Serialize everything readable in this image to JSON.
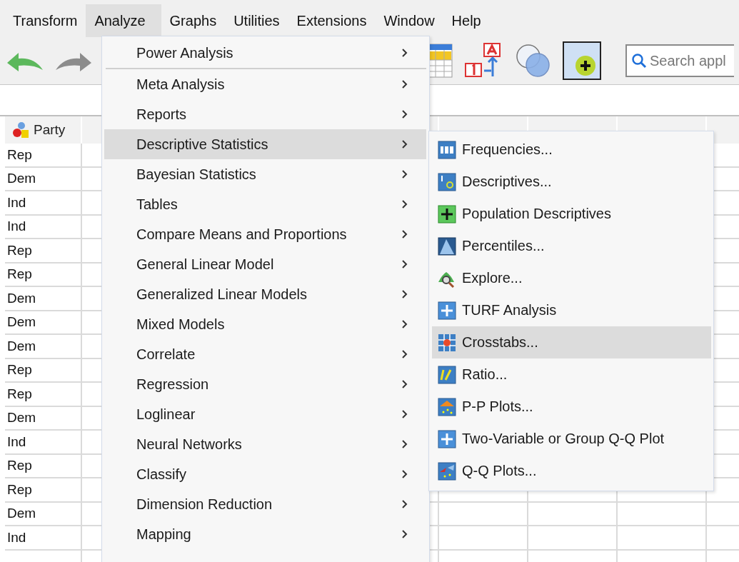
{
  "menubar": [
    {
      "label": "Transform",
      "selected": false
    },
    {
      "label": "Analyze",
      "selected": true
    },
    {
      "label": "Graphs",
      "selected": false
    },
    {
      "label": "Utilities",
      "selected": false
    },
    {
      "label": "Extensions",
      "selected": false
    },
    {
      "label": "Window",
      "selected": false
    },
    {
      "label": "Help",
      "selected": false
    }
  ],
  "toolbar": {
    "search": {
      "placeholder": "Search appl"
    }
  },
  "grid": {
    "columns": [
      "Party"
    ],
    "rows": [
      "Rep",
      "Dem",
      "Ind",
      "Ind",
      "Rep",
      "Rep",
      "Dem",
      "Dem",
      "Dem",
      "Rep",
      "Rep",
      "Dem",
      "Ind",
      "Rep",
      "Rep",
      "Dem",
      "Ind"
    ]
  },
  "analyze_menu": [
    {
      "label": "Power Analysis",
      "selected": false,
      "has_submenu": true,
      "separator_after": true
    },
    {
      "label": "Meta Analysis",
      "selected": false,
      "has_submenu": true,
      "separator_after": false
    },
    {
      "label": "Reports",
      "selected": false,
      "has_submenu": true,
      "separator_after": false
    },
    {
      "label": "Descriptive Statistics",
      "selected": true,
      "has_submenu": true,
      "separator_after": false
    },
    {
      "label": "Bayesian Statistics",
      "selected": false,
      "has_submenu": true,
      "separator_after": false
    },
    {
      "label": "Tables",
      "selected": false,
      "has_submenu": true,
      "separator_after": false
    },
    {
      "label": "Compare Means and Proportions",
      "selected": false,
      "has_submenu": true,
      "separator_after": false
    },
    {
      "label": "General Linear Model",
      "selected": false,
      "has_submenu": true,
      "separator_after": false
    },
    {
      "label": "Generalized Linear Models",
      "selected": false,
      "has_submenu": true,
      "separator_after": false
    },
    {
      "label": "Mixed Models",
      "selected": false,
      "has_submenu": true,
      "separator_after": false
    },
    {
      "label": "Correlate",
      "selected": false,
      "has_submenu": true,
      "separator_after": false
    },
    {
      "label": "Regression",
      "selected": false,
      "has_submenu": true,
      "separator_after": false
    },
    {
      "label": "Loglinear",
      "selected": false,
      "has_submenu": true,
      "separator_after": false
    },
    {
      "label": "Neural Networks",
      "selected": false,
      "has_submenu": true,
      "separator_after": false
    },
    {
      "label": "Classify",
      "selected": false,
      "has_submenu": true,
      "separator_after": false
    },
    {
      "label": "Dimension Reduction",
      "selected": false,
      "has_submenu": true,
      "separator_after": false
    },
    {
      "label": "Mapping",
      "selected": false,
      "has_submenu": true,
      "separator_after": false
    }
  ],
  "descriptive_submenu": [
    {
      "label": "Frequencies...",
      "selected": false
    },
    {
      "label": "Descriptives...",
      "selected": false
    },
    {
      "label": "Population Descriptives",
      "selected": false
    },
    {
      "label": "Percentiles...",
      "selected": false
    },
    {
      "label": "Explore...",
      "selected": false
    },
    {
      "label": "TURF Analysis",
      "selected": false
    },
    {
      "label": "Crosstabs...",
      "selected": true
    },
    {
      "label": "Ratio...",
      "selected": false
    },
    {
      "label": "P-P Plots...",
      "selected": false
    },
    {
      "label": "Two-Variable or Group Q-Q Plot",
      "selected": false
    },
    {
      "label": "Q-Q Plots...",
      "selected": false
    }
  ]
}
